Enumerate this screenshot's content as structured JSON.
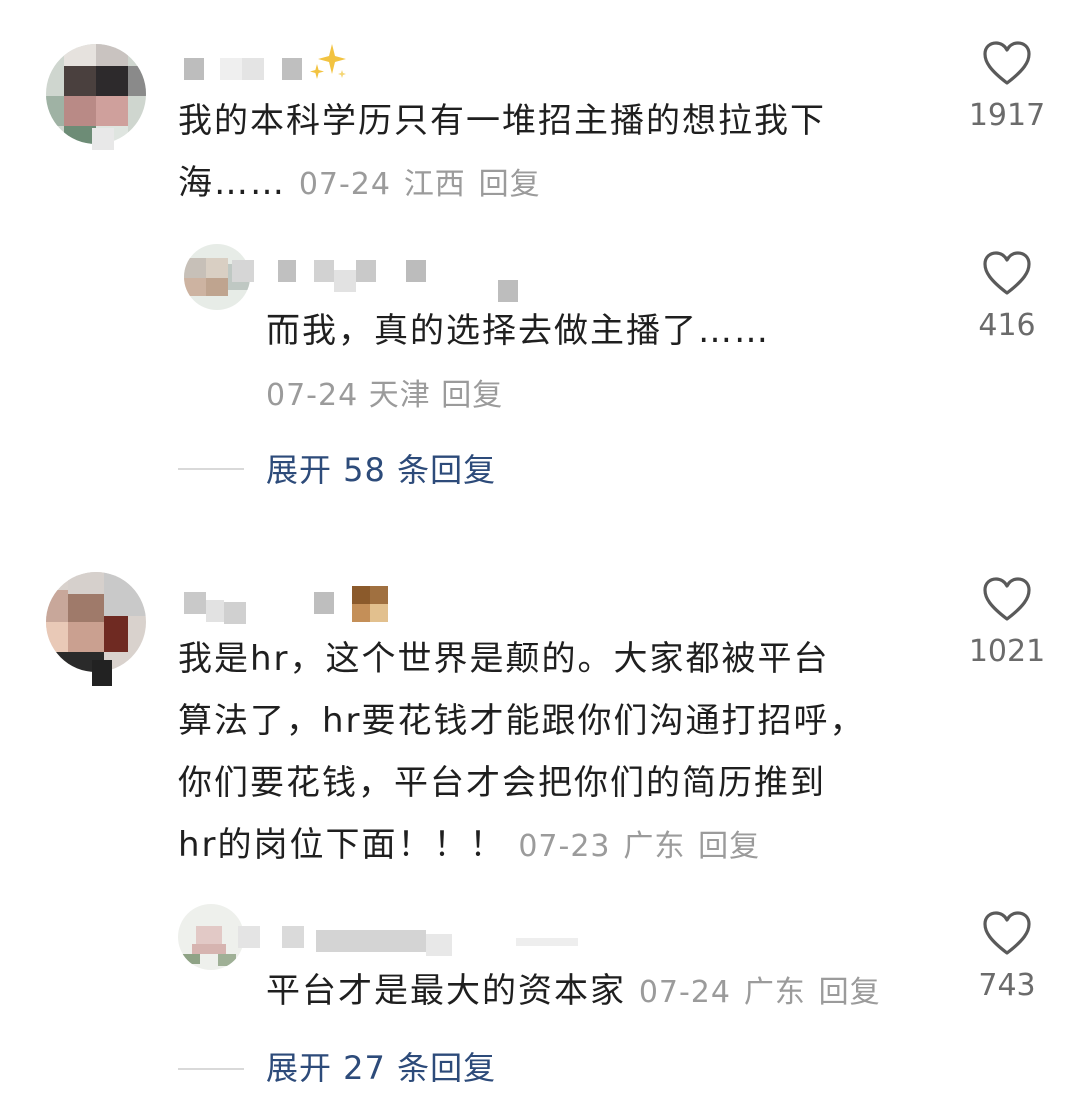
{
  "comments": [
    {
      "text_lines": [
        "我的本科学历只有一堆招主播的想拉我下",
        "海……"
      ],
      "date": "07-24",
      "location": "江西",
      "reply_label": "回复",
      "likes": "1917",
      "reply": {
        "text": "而我，真的选择去做主播了……",
        "date": "07-24",
        "location": "天津",
        "reply_label": "回复",
        "likes": "416"
      },
      "expand_label": "展开 58 条回复"
    },
    {
      "text_lines": [
        "我是hr，这个世界是颠的。大家都被平台",
        "算法了，hr要花钱才能跟你们沟通打招呼，",
        "你们要花钱，平台才会把你们的简历推到",
        "hr的岗位下面！！！"
      ],
      "date": "07-23",
      "location": "广东",
      "reply_label": "回复",
      "likes": "1021",
      "reply": {
        "text": "平台才是最大的资本家",
        "date": "07-24",
        "location": "广东",
        "reply_label": "回复",
        "likes": "743"
      },
      "expand_label": "展开 27 条回复"
    }
  ],
  "icons": {
    "like": "heart-outline-icon",
    "badge": "sparkle-icon"
  },
  "colors": {
    "text": "#1f1f1f",
    "meta": "#9b9b9b",
    "expand": "#2d4b7a",
    "icon": "#5a5a5a"
  }
}
